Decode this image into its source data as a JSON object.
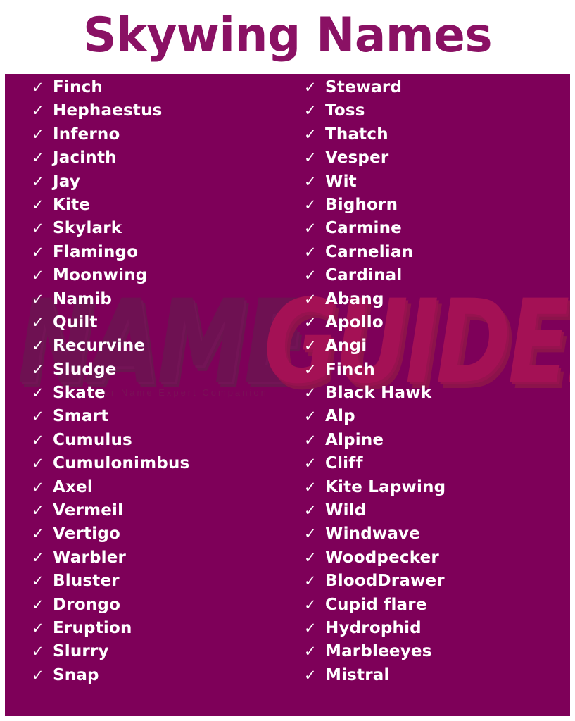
{
  "header": {
    "title": "Skywing Names"
  },
  "watermark": {
    "word_one": "NAME",
    "word_two": "GUIDER",
    "tagline": "Your Name Expert Companion"
  },
  "colors": {
    "panel_background": "#7E0059",
    "title_text": "#8A1164",
    "item_text": "#FFFFFF",
    "page_background": "#FFFFFF",
    "watermark_left": "#6E1152",
    "watermark_right": "#A41155"
  },
  "icons": {
    "check": "✓"
  },
  "list": {
    "columns": [
      {
        "id": "left",
        "items": [
          "Finch",
          "Hephaestus",
          "Inferno",
          "Jacinth",
          "Jay",
          "Kite",
          "Skylark",
          "Flamingo",
          "Moonwing",
          "Namib",
          "Quilt",
          "Recurvine",
          "Sludge",
          "Skate",
          "Smart",
          "Cumulus",
          "Cumulonimbus",
          "Axel",
          "Vermeil",
          "Vertigo",
          "Warbler",
          "Bluster",
          "Drongo",
          "Eruption",
          "Slurry",
          "Snap"
        ]
      },
      {
        "id": "right",
        "items": [
          "Steward",
          "Toss",
          "Thatch",
          "Vesper",
          "Wit",
          "Bighorn",
          "Carmine",
          "Carnelian",
          "Cardinal",
          "Abang",
          "Apollo",
          "Angi",
          "Finch",
          "Black Hawk",
          "Alp",
          "Alpine",
          "Cliff",
          "Kite Lapwing",
          "Wild",
          "Windwave",
          "Woodpecker",
          "BloodDrawer",
          "Cupid flare",
          "Hydrophid",
          "Marbleeyes",
          "Mistral"
        ]
      }
    ]
  }
}
